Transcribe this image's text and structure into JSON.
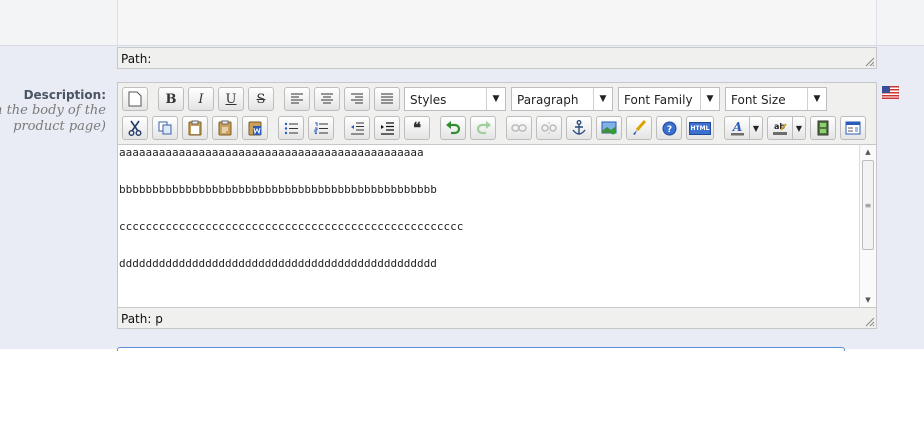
{
  "top_editor": {
    "path_label": "Path:"
  },
  "description": {
    "label": "Description:",
    "hint_line1": "(in the body of the",
    "hint_line2": "product page)"
  },
  "toolbar": {
    "bold": "B",
    "italic": "I",
    "underline": "U",
    "strike": "S",
    "styles_select": "Styles",
    "format_select": "Paragraph",
    "font_family_select": "Font Family",
    "font_size_select": "Font Size",
    "blockquote": "66",
    "html": "HTML"
  },
  "editor": {
    "lines": [
      "aaaaaaaaaaaaaaaaaaaaaaaaaaaaaaaaaaaaaaaaaaaaaa",
      "bbbbbbbbbbbbbbbbbbbbbbbbbbbbbbbbbbbbbbbbbbbbbbbb",
      "cccccccccccccccccccccccccccccccccccccccccccccccccccc",
      "dddddddddddddddddddddddddddddddddddddddddddddddd"
    ],
    "path_label": "Path: p"
  },
  "colors": {
    "band": "#e9ecf4",
    "accent": "#5b8fd6"
  }
}
